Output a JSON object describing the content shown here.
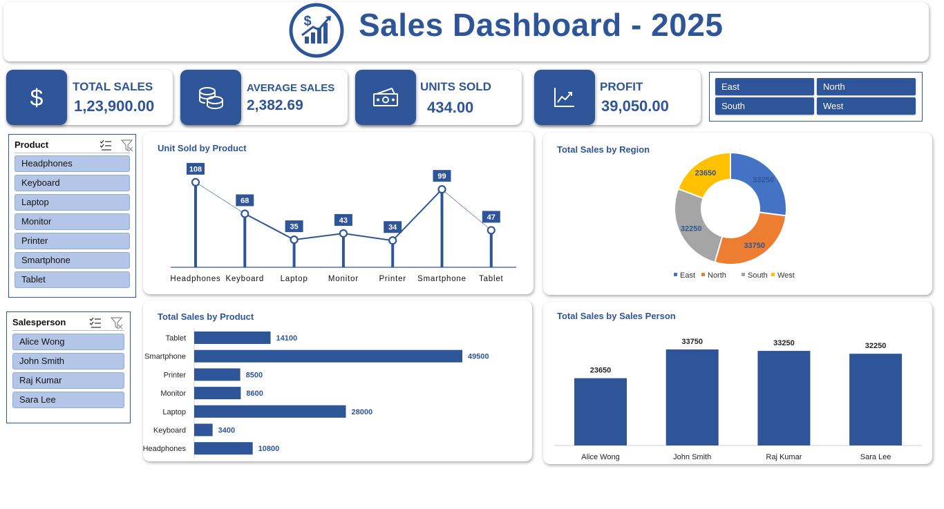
{
  "header": {
    "title": "Sales Dashboard - 2025",
    "logo_icon": "dollar-growth-chart-icon"
  },
  "kpis": [
    {
      "label": "TOTAL SALES",
      "value": "1,23,900.00",
      "icon": "dollar-icon"
    },
    {
      "label": "AVERAGE SALES",
      "value": "2,382.69",
      "icon": "coins-icon"
    },
    {
      "label": "UNITS SOLD",
      "value": "434.00",
      "icon": "banknote-icon"
    },
    {
      "label": "PROFIT",
      "value": "39,050.00",
      "icon": "line-chart-icon"
    }
  ],
  "region_slicer": {
    "items": [
      "East",
      "North",
      "South",
      "West"
    ]
  },
  "product_slicer": {
    "title": "Product",
    "items": [
      "Headphones",
      "Keyboard",
      "Laptop",
      "Monitor",
      "Printer",
      "Smartphone",
      "Tablet"
    ]
  },
  "salesperson_slicer": {
    "title": "Salesperson",
    "items": [
      "Alice Wong",
      "John Smith",
      "Raj Kumar",
      "Sara Lee"
    ]
  },
  "colors": {
    "primary": "#2E5597",
    "slicer_item": "#B4C6E7",
    "east": "#4472C4",
    "north": "#ED7D31",
    "south": "#A5A5A5",
    "west": "#FFC000"
  },
  "chart_data": [
    {
      "type": "line",
      "title": "Unit Sold by Product",
      "categories": [
        "Headphones",
        "Keyboard",
        "Laptop",
        "Monitor",
        "Printer",
        "Smartphone",
        "Tablet"
      ],
      "values": [
        108,
        68,
        35,
        43,
        34,
        99,
        47
      ],
      "ylim": [
        0,
        120
      ],
      "grid": false,
      "legend": "none"
    },
    {
      "type": "pie",
      "title": "Total Sales by Region",
      "categories": [
        "East",
        "North",
        "South",
        "West"
      ],
      "values": [
        33250,
        33750,
        32250,
        23650
      ],
      "legend": "bottom"
    },
    {
      "type": "bar",
      "orientation": "horizontal",
      "title": "Total Sales by Product",
      "categories": [
        "Tablet",
        "Smartphone",
        "Printer",
        "Monitor",
        "Laptop",
        "Keyboard",
        "Headphones"
      ],
      "values": [
        14100,
        49500,
        8500,
        8600,
        28000,
        3400,
        10800
      ],
      "xlim": [
        0,
        55000
      ],
      "grid": false,
      "legend": "none"
    },
    {
      "type": "bar",
      "title": "Total Sales by Sales Person",
      "categories": [
        "Alice Wong",
        "John Smith",
        "Raj Kumar",
        "Sara Lee"
      ],
      "values": [
        23650,
        33750,
        33250,
        32250
      ],
      "ylim": [
        0,
        40000
      ],
      "grid": false,
      "legend": "none"
    }
  ]
}
